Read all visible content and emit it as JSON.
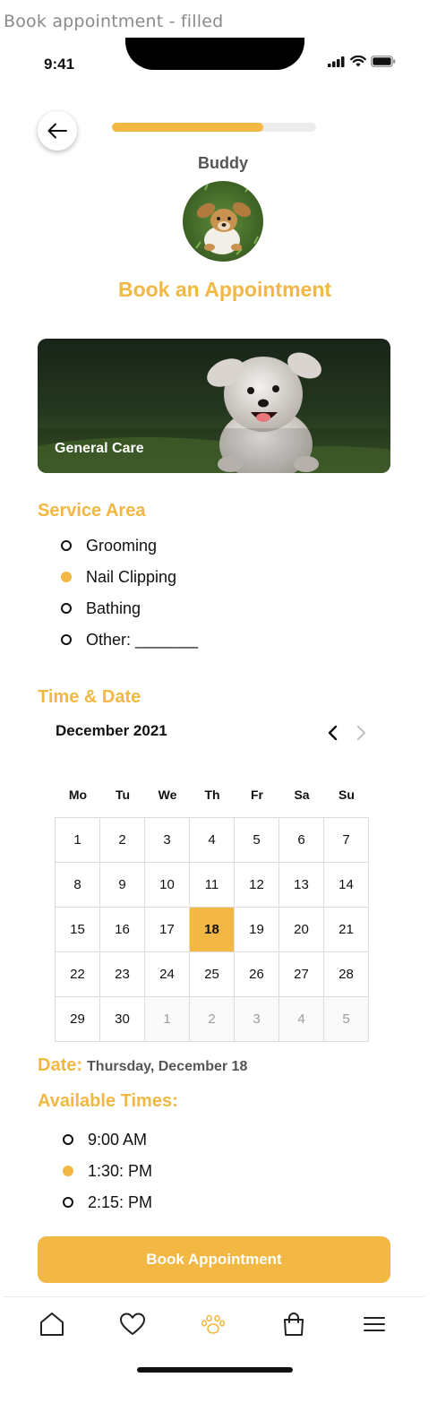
{
  "frame_label": "Book appointment - filled",
  "status_bar": {
    "time": "9:41"
  },
  "progress": {
    "fraction": 0.74
  },
  "pet": {
    "name": "Buddy"
  },
  "page_title": "Book an Appointment",
  "care_card": {
    "label": "General Care"
  },
  "service_area": {
    "title": "Service Area",
    "options": [
      {
        "label": "Grooming",
        "selected": false
      },
      {
        "label": "Nail Clipping",
        "selected": true
      },
      {
        "label": "Bathing",
        "selected": false
      },
      {
        "label": "Other: _______",
        "selected": false
      }
    ]
  },
  "time_date": {
    "title": "Time & Date",
    "month": "December 2021",
    "weekdays": [
      "Mo",
      "Tu",
      "We",
      "Th",
      "Fr",
      "Sa",
      "Su"
    ],
    "weeks": [
      [
        "1",
        "2",
        "3",
        "4",
        "5",
        "6",
        "7"
      ],
      [
        "8",
        "9",
        "10",
        "11",
        "12",
        "13",
        "14"
      ],
      [
        "15",
        "16",
        "17",
        "18",
        "19",
        "20",
        "21"
      ],
      [
        "22",
        "23",
        "24",
        "25",
        "26",
        "27",
        "28"
      ],
      [
        "29",
        "30",
        "1",
        "2",
        "3",
        "4",
        "5"
      ]
    ],
    "selected_day": "18"
  },
  "date": {
    "label": "Date:",
    "value": "Thursday, December 18"
  },
  "times": {
    "title": "Available Times:",
    "options": [
      {
        "label": "9:00 AM",
        "selected": false
      },
      {
        "label": "1:30: PM",
        "selected": true
      },
      {
        "label": "2:15: PM",
        "selected": false
      }
    ]
  },
  "cta": {
    "label": "Book Appointment"
  },
  "tabbar": {
    "items": [
      "home-icon",
      "heart-icon",
      "paw-icon",
      "shopping-bag-icon",
      "menu-icon"
    ],
    "active": "paw-icon"
  },
  "colors": {
    "accent": "#f2b843",
    "text": "#111111",
    "muted": "#555555"
  }
}
